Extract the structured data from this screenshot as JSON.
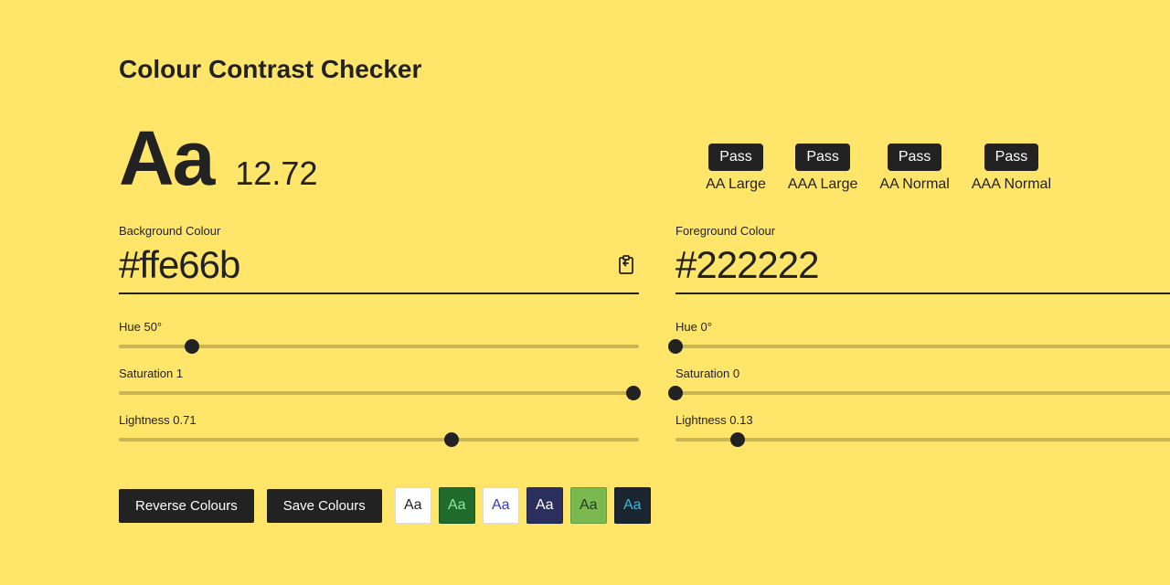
{
  "title": "Colour Contrast Checker",
  "sample_text": "Aa",
  "ratio": "12.72",
  "badges": [
    {
      "result": "Pass",
      "label": "AA Large"
    },
    {
      "result": "Pass",
      "label": "AAA Large"
    },
    {
      "result": "Pass",
      "label": "AA Normal"
    },
    {
      "result": "Pass",
      "label": "AAA Normal"
    }
  ],
  "background": {
    "label": "Background Colour",
    "hex": "#ffe66b",
    "sliders": {
      "hue": {
        "label": "Hue 50°",
        "pct": 14
      },
      "saturation": {
        "label": "Saturation 1",
        "pct": 99
      },
      "lightness": {
        "label": "Lightness 0.71",
        "pct": 64
      }
    }
  },
  "foreground": {
    "label": "Foreground Colour",
    "hex": "#222222",
    "sliders": {
      "hue": {
        "label": "Hue 0°",
        "pct": 0
      },
      "saturation": {
        "label": "Saturation 0",
        "pct": 0
      },
      "lightness": {
        "label": "Lightness 0.13",
        "pct": 12
      }
    }
  },
  "buttons": {
    "reverse": "Reverse Colours",
    "save": "Save Colours"
  },
  "swatches": [
    {
      "bg": "#ffffff",
      "fg": "#222222"
    },
    {
      "bg": "#1f6b2c",
      "fg": "#8fe79e"
    },
    {
      "bg": "#ffffff",
      "fg": "#3a3ac8"
    },
    {
      "bg": "#2a2f5e",
      "fg": "#ffffff"
    },
    {
      "bg": "#7ab94f",
      "fg": "#1f3b17"
    },
    {
      "bg": "#1a2530",
      "fg": "#3fb8d6"
    }
  ],
  "swatch_text": "Aa"
}
